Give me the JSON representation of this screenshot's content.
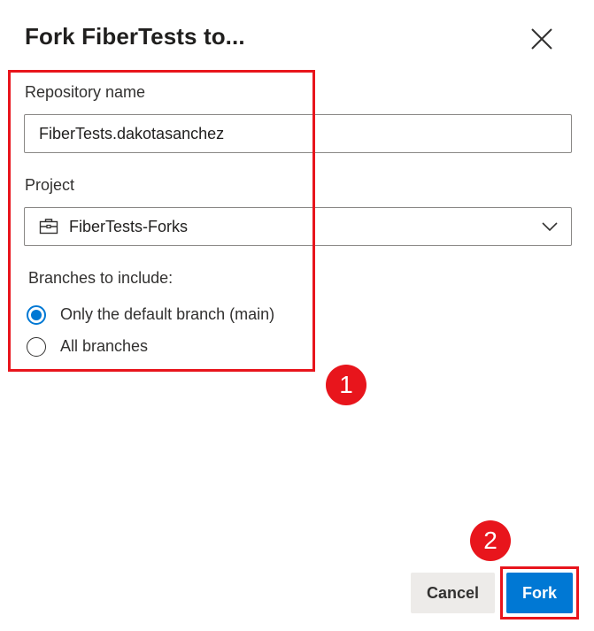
{
  "dialog": {
    "title": "Fork FiberTests to..."
  },
  "form": {
    "repo_label": "Repository name",
    "repo_value": "FiberTests.dakotasanchez",
    "project_label": "Project",
    "project_value": "FiberTests-Forks",
    "branches_label": "Branches to include:",
    "branch_options": [
      {
        "label": "Only the default branch (main)",
        "checked": true
      },
      {
        "label": "All branches",
        "checked": false
      }
    ]
  },
  "footer": {
    "cancel_label": "Cancel",
    "fork_label": "Fork"
  },
  "annotations": {
    "step1": "1",
    "step2": "2"
  },
  "icons": {
    "close": "close-icon",
    "project": "project-briefcase-icon",
    "dropdown": "chevron-down-icon"
  },
  "colors": {
    "accent": "#0078d4",
    "annotation": "#e8151c",
    "cancel_bg": "#edebe9"
  }
}
